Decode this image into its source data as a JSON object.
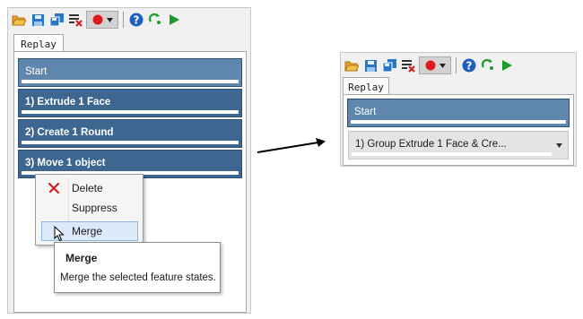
{
  "left_panel": {
    "tab_label": "Replay",
    "items": [
      {
        "label": "Start"
      },
      {
        "label": "1) Extrude 1 Face"
      },
      {
        "label": "2) Create 1 Round"
      },
      {
        "label": "3) Move 1 object"
      }
    ],
    "context_menu": {
      "items": [
        {
          "label": "Delete"
        },
        {
          "label": "Suppress"
        },
        {
          "label": "Merge"
        }
      ]
    },
    "tooltip": {
      "title": "Merge",
      "description": "Merge the selected feature states."
    }
  },
  "right_panel": {
    "tab_label": "Replay",
    "items": [
      {
        "label": "Start"
      }
    ],
    "group_combo": {
      "value": "1) Group Extrude 1 Face & Cre..."
    }
  },
  "toolbar_icons": [
    "open-folder-icon",
    "save-icon",
    "save-all-icon",
    "clear-list-icon",
    "record-icon",
    "help-icon",
    "loop-icon",
    "play-icon"
  ],
  "colors": {
    "feature_bar": "#3d6791",
    "start_bar": "#5f86ad",
    "record_red": "#e11b1b",
    "play_green": "#1e9a2a",
    "help_blue": "#1f5fc0"
  }
}
